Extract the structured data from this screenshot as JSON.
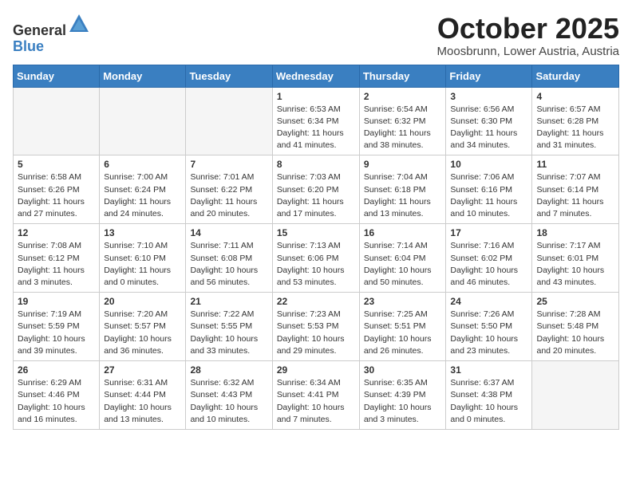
{
  "header": {
    "logo_line1": "General",
    "logo_line2": "Blue",
    "month": "October 2025",
    "location": "Moosbrunn, Lower Austria, Austria"
  },
  "weekdays": [
    "Sunday",
    "Monday",
    "Tuesday",
    "Wednesday",
    "Thursday",
    "Friday",
    "Saturday"
  ],
  "weeks": [
    [
      {
        "day": "",
        "info": ""
      },
      {
        "day": "",
        "info": ""
      },
      {
        "day": "",
        "info": ""
      },
      {
        "day": "1",
        "info": "Sunrise: 6:53 AM\nSunset: 6:34 PM\nDaylight: 11 hours\nand 41 minutes."
      },
      {
        "day": "2",
        "info": "Sunrise: 6:54 AM\nSunset: 6:32 PM\nDaylight: 11 hours\nand 38 minutes."
      },
      {
        "day": "3",
        "info": "Sunrise: 6:56 AM\nSunset: 6:30 PM\nDaylight: 11 hours\nand 34 minutes."
      },
      {
        "day": "4",
        "info": "Sunrise: 6:57 AM\nSunset: 6:28 PM\nDaylight: 11 hours\nand 31 minutes."
      }
    ],
    [
      {
        "day": "5",
        "info": "Sunrise: 6:58 AM\nSunset: 6:26 PM\nDaylight: 11 hours\nand 27 minutes."
      },
      {
        "day": "6",
        "info": "Sunrise: 7:00 AM\nSunset: 6:24 PM\nDaylight: 11 hours\nand 24 minutes."
      },
      {
        "day": "7",
        "info": "Sunrise: 7:01 AM\nSunset: 6:22 PM\nDaylight: 11 hours\nand 20 minutes."
      },
      {
        "day": "8",
        "info": "Sunrise: 7:03 AM\nSunset: 6:20 PM\nDaylight: 11 hours\nand 17 minutes."
      },
      {
        "day": "9",
        "info": "Sunrise: 7:04 AM\nSunset: 6:18 PM\nDaylight: 11 hours\nand 13 minutes."
      },
      {
        "day": "10",
        "info": "Sunrise: 7:06 AM\nSunset: 6:16 PM\nDaylight: 11 hours\nand 10 minutes."
      },
      {
        "day": "11",
        "info": "Sunrise: 7:07 AM\nSunset: 6:14 PM\nDaylight: 11 hours\nand 7 minutes."
      }
    ],
    [
      {
        "day": "12",
        "info": "Sunrise: 7:08 AM\nSunset: 6:12 PM\nDaylight: 11 hours\nand 3 minutes."
      },
      {
        "day": "13",
        "info": "Sunrise: 7:10 AM\nSunset: 6:10 PM\nDaylight: 11 hours\nand 0 minutes."
      },
      {
        "day": "14",
        "info": "Sunrise: 7:11 AM\nSunset: 6:08 PM\nDaylight: 10 hours\nand 56 minutes."
      },
      {
        "day": "15",
        "info": "Sunrise: 7:13 AM\nSunset: 6:06 PM\nDaylight: 10 hours\nand 53 minutes."
      },
      {
        "day": "16",
        "info": "Sunrise: 7:14 AM\nSunset: 6:04 PM\nDaylight: 10 hours\nand 50 minutes."
      },
      {
        "day": "17",
        "info": "Sunrise: 7:16 AM\nSunset: 6:02 PM\nDaylight: 10 hours\nand 46 minutes."
      },
      {
        "day": "18",
        "info": "Sunrise: 7:17 AM\nSunset: 6:01 PM\nDaylight: 10 hours\nand 43 minutes."
      }
    ],
    [
      {
        "day": "19",
        "info": "Sunrise: 7:19 AM\nSunset: 5:59 PM\nDaylight: 10 hours\nand 39 minutes."
      },
      {
        "day": "20",
        "info": "Sunrise: 7:20 AM\nSunset: 5:57 PM\nDaylight: 10 hours\nand 36 minutes."
      },
      {
        "day": "21",
        "info": "Sunrise: 7:22 AM\nSunset: 5:55 PM\nDaylight: 10 hours\nand 33 minutes."
      },
      {
        "day": "22",
        "info": "Sunrise: 7:23 AM\nSunset: 5:53 PM\nDaylight: 10 hours\nand 29 minutes."
      },
      {
        "day": "23",
        "info": "Sunrise: 7:25 AM\nSunset: 5:51 PM\nDaylight: 10 hours\nand 26 minutes."
      },
      {
        "day": "24",
        "info": "Sunrise: 7:26 AM\nSunset: 5:50 PM\nDaylight: 10 hours\nand 23 minutes."
      },
      {
        "day": "25",
        "info": "Sunrise: 7:28 AM\nSunset: 5:48 PM\nDaylight: 10 hours\nand 20 minutes."
      }
    ],
    [
      {
        "day": "26",
        "info": "Sunrise: 6:29 AM\nSunset: 4:46 PM\nDaylight: 10 hours\nand 16 minutes."
      },
      {
        "day": "27",
        "info": "Sunrise: 6:31 AM\nSunset: 4:44 PM\nDaylight: 10 hours\nand 13 minutes."
      },
      {
        "day": "28",
        "info": "Sunrise: 6:32 AM\nSunset: 4:43 PM\nDaylight: 10 hours\nand 10 minutes."
      },
      {
        "day": "29",
        "info": "Sunrise: 6:34 AM\nSunset: 4:41 PM\nDaylight: 10 hours\nand 7 minutes."
      },
      {
        "day": "30",
        "info": "Sunrise: 6:35 AM\nSunset: 4:39 PM\nDaylight: 10 hours\nand 3 minutes."
      },
      {
        "day": "31",
        "info": "Sunrise: 6:37 AM\nSunset: 4:38 PM\nDaylight: 10 hours\nand 0 minutes."
      },
      {
        "day": "",
        "info": ""
      }
    ]
  ]
}
